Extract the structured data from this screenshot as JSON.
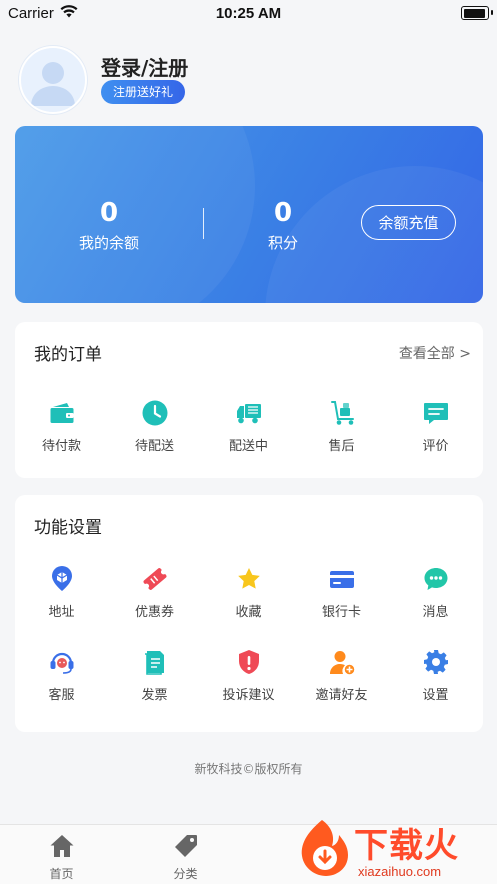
{
  "status_bar": {
    "carrier": "Carrier",
    "time": "10:25 AM"
  },
  "profile": {
    "name": "登录/注册",
    "badge": "注册送好礼"
  },
  "wallet": {
    "balance_value": "0",
    "balance_label": "我的余额",
    "points_value": "0",
    "points_label": "积分",
    "recharge_label": "余额充值"
  },
  "orders": {
    "title": "我的订单",
    "view_all": "查看全部 >",
    "items": [
      {
        "label": "待付款",
        "icon": "wallet-icon"
      },
      {
        "label": "待配送",
        "icon": "clock-icon"
      },
      {
        "label": "配送中",
        "icon": "truck-icon"
      },
      {
        "label": "售后",
        "icon": "hand-truck-icon"
      },
      {
        "label": "评价",
        "icon": "comment-icon"
      }
    ]
  },
  "features": {
    "title": "功能设置",
    "items": [
      {
        "label": "地址",
        "icon": "location-icon"
      },
      {
        "label": "优惠券",
        "icon": "coupon-icon"
      },
      {
        "label": "收藏",
        "icon": "star-icon"
      },
      {
        "label": "银行卡",
        "icon": "bank-card-icon"
      },
      {
        "label": "消息",
        "icon": "message-icon"
      },
      {
        "label": "客服",
        "icon": "headset-icon"
      },
      {
        "label": "发票",
        "icon": "invoice-icon"
      },
      {
        "label": "投诉建议",
        "icon": "shield-alert-icon"
      },
      {
        "label": "邀请好友",
        "icon": "add-user-icon"
      },
      {
        "label": "设置",
        "icon": "gear-icon"
      }
    ]
  },
  "copyright": "新牧科技©版权所有",
  "tabs": [
    {
      "label": "首页",
      "icon": "home-icon"
    },
    {
      "label": "分类",
      "icon": "tag-icon"
    }
  ],
  "watermark": {
    "text": "下载火",
    "url": "xiazaihuo.com"
  },
  "colors": {
    "accent": "#3a7fe5",
    "teal": "#1fbfb8",
    "orange": "#ff8a1c",
    "red": "#ef4a56",
    "background": "#f5f6f8"
  }
}
